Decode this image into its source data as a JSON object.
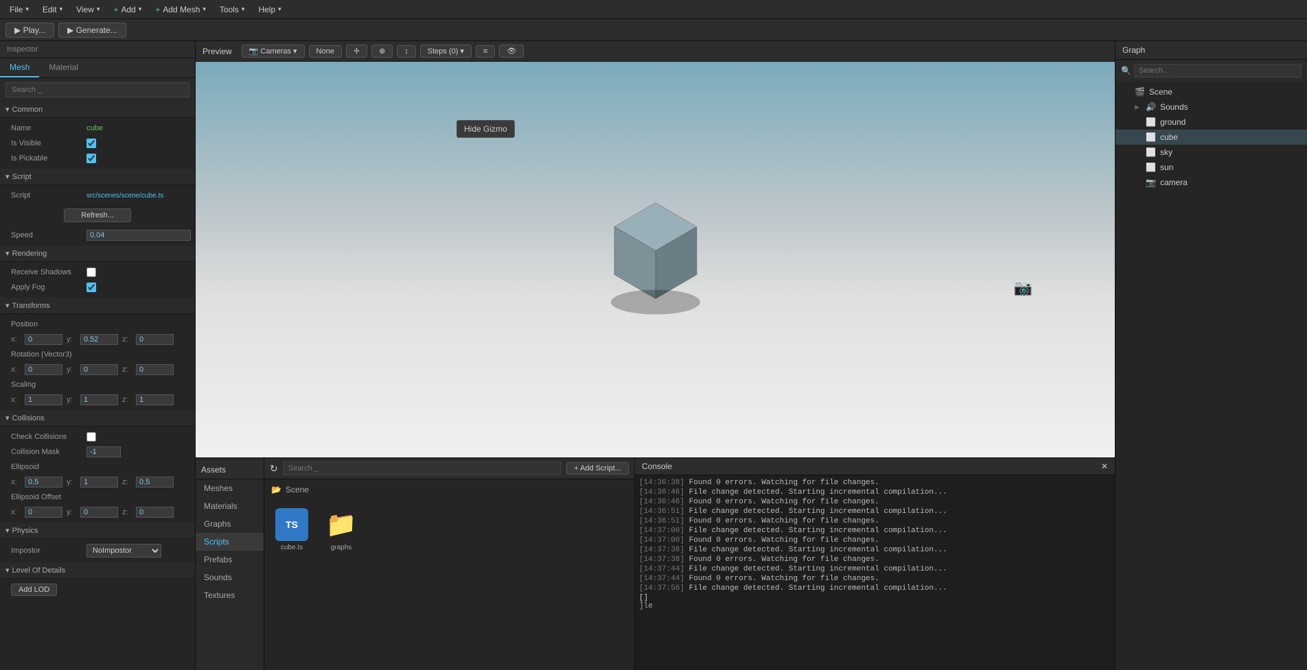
{
  "menubar": {
    "items": [
      "File",
      "Edit",
      "View",
      "Add",
      "Add Mesh",
      "Tools",
      "Help"
    ]
  },
  "toolbar": {
    "play_label": "▶  Play...",
    "generate_label": "▶  Generate..."
  },
  "inspector": {
    "title": "Inspector",
    "tabs": [
      "Mesh",
      "Material"
    ],
    "active_tab": "Mesh",
    "search_placeholder": "Search _",
    "sections": {
      "common": {
        "label": "Common",
        "name_label": "Name",
        "name_value": "cube",
        "is_visible_label": "Is Visible",
        "is_visible_checked": true,
        "is_pickable_label": "Is Pickable",
        "is_pickable_checked": true
      },
      "script": {
        "label": "Script",
        "script_label": "Script",
        "script_value": "src/scenes/scene/cube.ts",
        "refresh_label": "Refresh...",
        "speed_label": "Speed",
        "speed_value": "0.04"
      },
      "rendering": {
        "label": "Rendering",
        "receive_shadows_label": "Receive Shadows",
        "receive_shadows_checked": false,
        "apply_fog_label": "Apply Fog",
        "apply_fog_checked": true
      },
      "transforms": {
        "label": "Transforms",
        "position_label": "Position",
        "position_x": "0",
        "position_y": "0.52",
        "position_z": "0",
        "rotation_label": "Rotation (Vector3)",
        "rotation_x": "0",
        "rotation_y": "0",
        "rotation_z": "0",
        "scaling_label": "Scaling",
        "scaling_x": "1",
        "scaling_y": "1",
        "scaling_z": "1"
      },
      "collisions": {
        "label": "Collisions",
        "check_label": "Check Collisions",
        "check_checked": false,
        "mask_label": "Collision Mask",
        "mask_value": "-1",
        "ellipsoid_label": "Ellipsoid",
        "ellipsoid_x": "0.5",
        "ellipsoid_y": "1",
        "ellipsoid_z": "0.5",
        "offset_label": "Ellipsoid Offset",
        "offset_x": "0",
        "offset_y": "0",
        "offset_z": "0"
      },
      "physics": {
        "label": "Physics",
        "impostor_label": "Impostor",
        "impostor_value": "NoImpostor"
      },
      "lod": {
        "label": "Level Of Details",
        "add_label": "Add LOD"
      }
    }
  },
  "preview": {
    "title": "Preview",
    "cameras_label": "Cameras",
    "none_label": "None",
    "steps_label": "Steps (0)",
    "gizmo_tooltip": "Hide Gizmo"
  },
  "assets": {
    "title": "Assets",
    "search_placeholder": "Search _",
    "add_script_label": "+ Add Script...",
    "nav_items": [
      "Meshes",
      "Materials",
      "Graphs",
      "Scripts",
      "Prefabs",
      "Sounds",
      "Textures"
    ],
    "active_nav": "Scripts",
    "scene_label": "Scene",
    "files": [
      {
        "name": "cube.ts",
        "type": "ts"
      },
      {
        "name": "graphs",
        "type": "folder"
      }
    ]
  },
  "console": {
    "title": "Console",
    "lines": [
      {
        "timestamp": "[14:36:38]",
        "msg": " Found 0 errors. Watching for file changes."
      },
      {
        "timestamp": "[14:36:46]",
        "msg": " File change detected. Starting incremental compilation..."
      },
      {
        "timestamp": "[14:36:46]",
        "msg": " Found 0 errors. Watching for file changes."
      },
      {
        "timestamp": "[14:36:51]",
        "msg": " File change detected. Starting incremental compilation..."
      },
      {
        "timestamp": "[14:36:51]",
        "msg": " Found 0 errors. Watching for file changes."
      },
      {
        "timestamp": "[14:37:00]",
        "msg": " File change detected. Starting incremental compilation..."
      },
      {
        "timestamp": "[14:37:00]",
        "msg": " Found 0 errors. Watching for file changes."
      },
      {
        "timestamp": "[14:37:38]",
        "msg": " File change detected. Starting incremental compilation..."
      },
      {
        "timestamp": "[14:37:38]",
        "msg": " Found 0 errors. Watching for file changes."
      },
      {
        "timestamp": "[14:37:44]",
        "msg": " File change detected. Starting incremental compilation..."
      },
      {
        "timestamp": "[14:37:44]",
        "msg": " Found 0 errors. Watching for file changes."
      },
      {
        "timestamp": "[14:37:56]",
        "msg": " File change detected. Starting incremental compilation..."
      }
    ]
  },
  "graph": {
    "title": "Graph",
    "search_placeholder": "Search...",
    "tree": [
      {
        "label": "Scene",
        "icon": "🎬",
        "level": 0,
        "arrow": ""
      },
      {
        "label": "Sounds",
        "icon": "🔊",
        "level": 1,
        "arrow": "▶"
      },
      {
        "label": "ground",
        "icon": "⬜",
        "level": 1,
        "arrow": ""
      },
      {
        "label": "cube",
        "icon": "⬜",
        "level": 1,
        "arrow": "",
        "selected": true
      },
      {
        "label": "sky",
        "icon": "⬜",
        "level": 1,
        "arrow": ""
      },
      {
        "label": "sun",
        "icon": "⬜",
        "level": 1,
        "arrow": ""
      },
      {
        "label": "camera",
        "icon": "📷",
        "level": 1,
        "arrow": ""
      }
    ]
  }
}
